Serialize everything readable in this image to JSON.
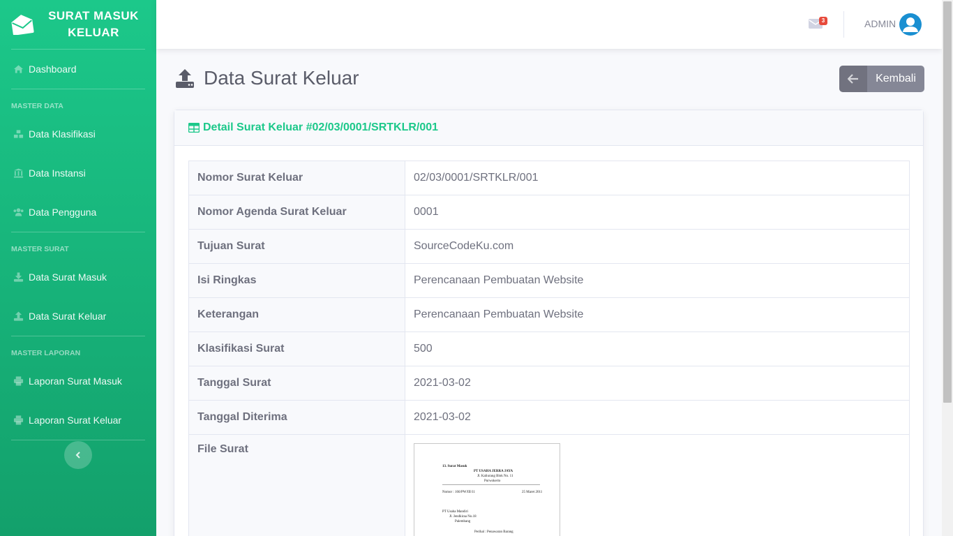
{
  "brand": {
    "line1": "SURAT MASUK",
    "line2": "KELUAR"
  },
  "sidebar": {
    "dashboard": "Dashboard",
    "heading_master_data": "MASTER DATA",
    "data_klasifikasi": "Data Klasifikasi",
    "data_instansi": "Data Instansi",
    "data_pengguna": "Data Pengguna",
    "heading_master_surat": "MASTER SURAT",
    "data_surat_masuk": "Data Surat Masuk",
    "data_surat_keluar": "Data Surat Keluar",
    "heading_master_laporan": "MASTER LAPORAN",
    "laporan_surat_masuk": "Laporan Surat Masuk",
    "laporan_surat_keluar": "Laporan Surat Keluar"
  },
  "topbar": {
    "mail_count": "3",
    "user": "ADMIN"
  },
  "page": {
    "title": "Data Surat Keluar",
    "back_label": "Kembali"
  },
  "card": {
    "title": "Detail Surat Keluar #02/03/0001/SRTKLR/001",
    "rows": [
      {
        "key": "Nomor Surat Keluar",
        "value": "02/03/0001/SRTKLR/001"
      },
      {
        "key": "Nomor Agenda Surat Keluar",
        "value": "0001"
      },
      {
        "key": "Tujuan Surat",
        "value": "SourceCodeKu.com"
      },
      {
        "key": "Isi Ringkas",
        "value": "Perencanaan Pembuatan Website"
      },
      {
        "key": "Keterangan",
        "value": "Perencanaan Pembuatan Website"
      },
      {
        "key": "Klasifikasi Surat",
        "value": "500"
      },
      {
        "key": "Tanggal Surat",
        "value": "2021-03-02"
      },
      {
        "key": "Tanggal Diterima",
        "value": "2021-03-02"
      }
    ],
    "file_label": "File Surat",
    "doc": {
      "heading": "13. Surat Masuk",
      "company": "PT USAHA JERRA JAYA",
      "address": "Jl. Kaliurang Blok No. 11",
      "city": "Purwokerto",
      "nomor": "Nomor : 166/PW/III/11",
      "date": "25 Maret 2011",
      "to1": "PT Usaha Mandiri",
      "to2": "Jl. Jendkiraa No.18",
      "to3": "Palembang",
      "subject": "Perihal : Penawaran Barang"
    }
  },
  "colors": {
    "primary": "#1cc88a",
    "secondary": "#858796",
    "danger": "#e74a3b"
  }
}
